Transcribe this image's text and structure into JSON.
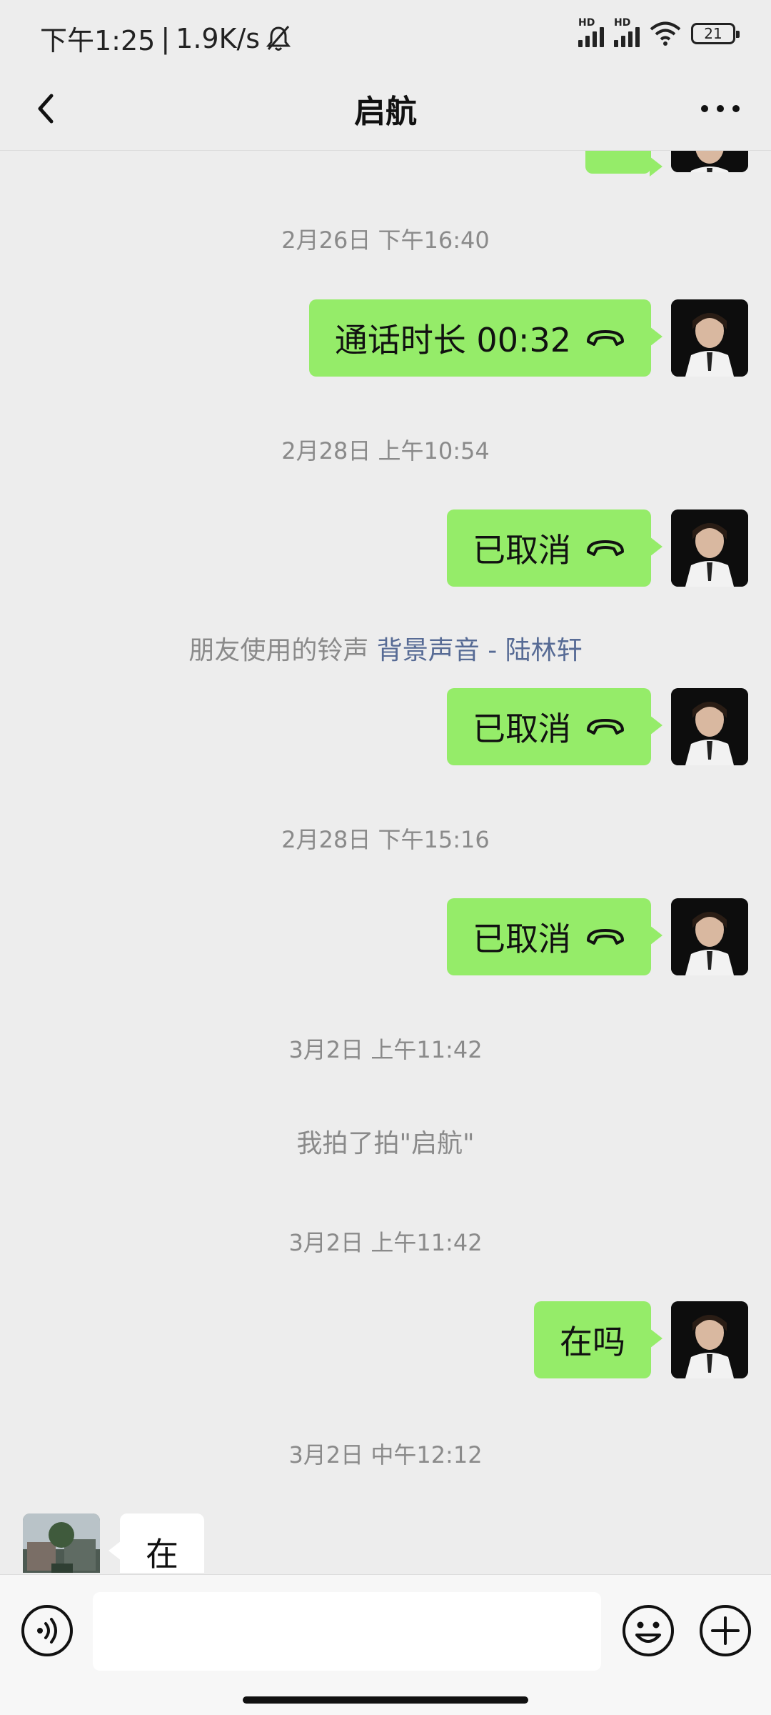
{
  "status": {
    "time": "下午1:25",
    "speed": "1.9K/s",
    "battery": "21",
    "hd1": "HD",
    "hd2": "HD"
  },
  "header": {
    "title": "启航"
  },
  "messages": {
    "ts1": "2月26日 下午16:40",
    "call1": "通话时长 00:32",
    "ts2": "2月28日 上午10:54",
    "cancel1": "已取消",
    "ringtone_prefix": "朋友使用的铃声",
    "ringtone_link": "背景声音 - 陆林轩",
    "cancel2": "已取消",
    "ts3": "2月28日 下午15:16",
    "cancel3": "已取消",
    "ts4": "3月2日 上午11:42",
    "pat": "我拍了拍\"启航\"",
    "ts5": "3月2日 上午11:42",
    "msg_me": "在吗",
    "ts6": "3月2日 中午12:12",
    "msg_other": "在"
  },
  "input": {
    "placeholder": ""
  },
  "colors": {
    "bubble_me": "#95ec69",
    "bubble_other": "#ffffff",
    "background": "#ededed",
    "link": "#576b95"
  },
  "icons": {
    "back": "chevron-left-icon",
    "more": "more-dots-icon",
    "hangup": "phone-hangup-icon",
    "voice": "voice-icon",
    "emoji": "emoji-icon",
    "plus": "plus-icon",
    "mute": "bell-off-icon",
    "wifi": "wifi-icon"
  }
}
